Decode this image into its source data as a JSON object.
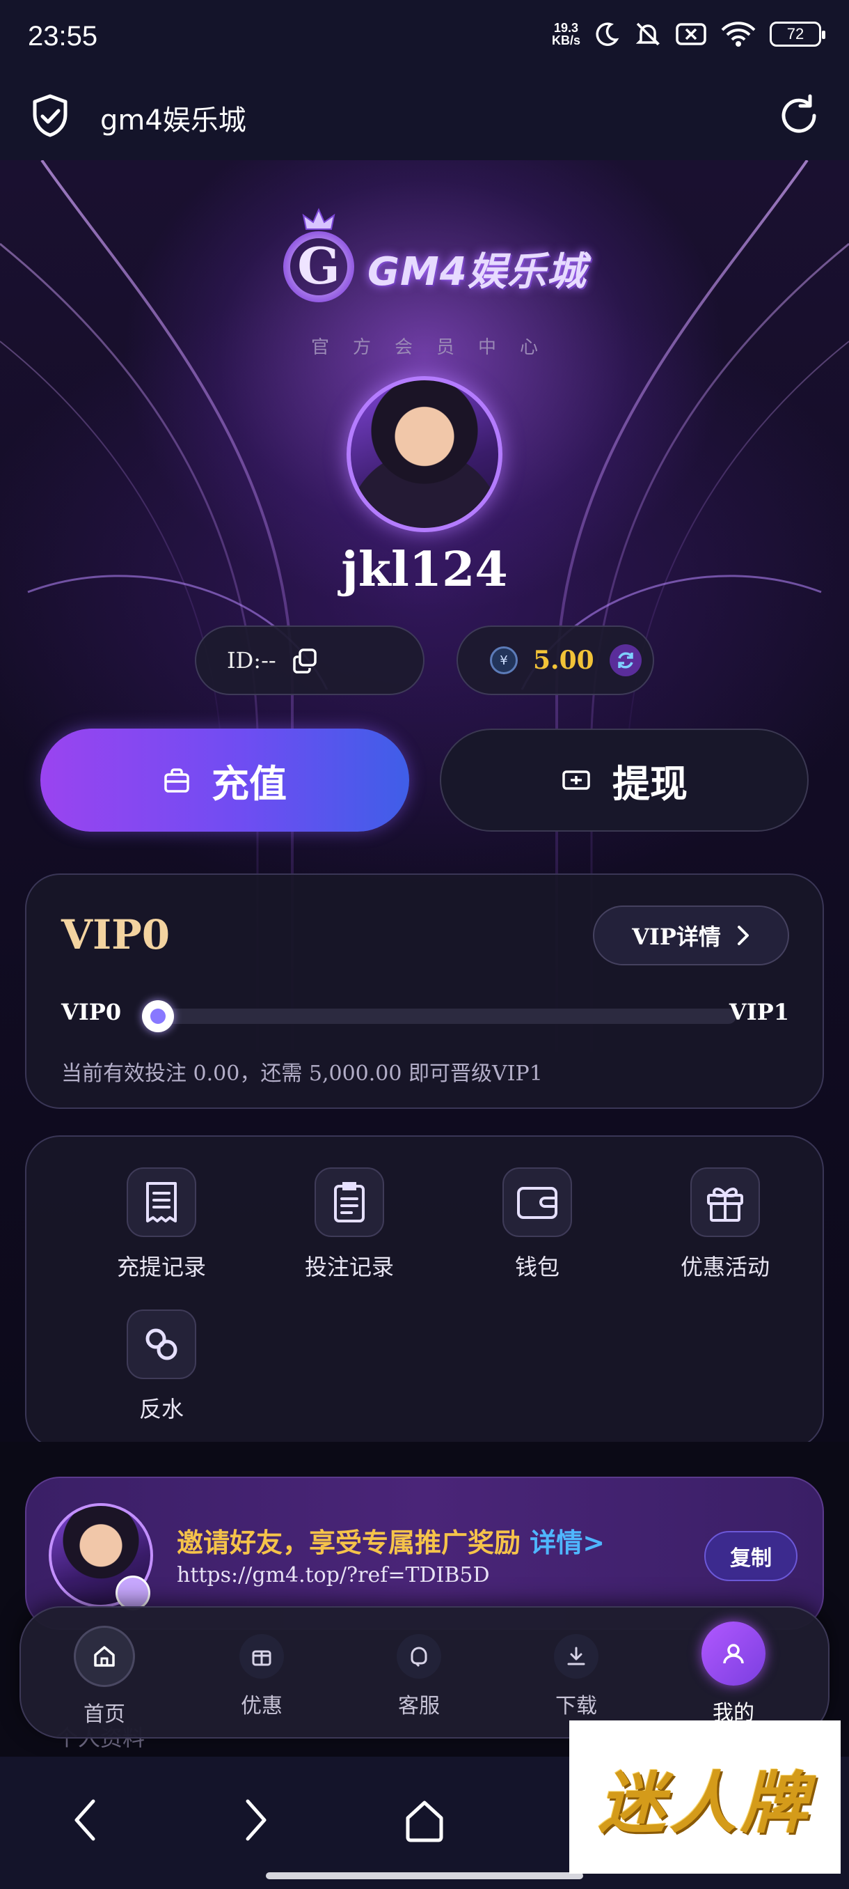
{
  "status_bar": {
    "time": "23:55",
    "speed_value": "19.3",
    "speed_unit": "KB/s",
    "battery": "72"
  },
  "header": {
    "title": "gm4娱乐城"
  },
  "hero": {
    "logo_text": "GM4娱乐城",
    "subtitle": "官方会员中心",
    "username": "jkl124"
  },
  "account": {
    "id_label": "ID:--",
    "currency_symbol": "¥",
    "balance": "5.00"
  },
  "actions": {
    "recharge_label": "充值",
    "withdraw_label": "提现"
  },
  "vip": {
    "current_level": "VIP0",
    "detail_label": "VIP详情",
    "start_label": "VIP0",
    "end_label": "VIP1",
    "progress": 0,
    "note": "当前有效投注 0.00，还需 5,000.00 即可晋级VIP1"
  },
  "menu": {
    "items": [
      {
        "label": "充提记录",
        "icon": "receipt-icon"
      },
      {
        "label": "投注记录",
        "icon": "clipboard-icon"
      },
      {
        "label": "钱包",
        "icon": "wallet-icon"
      },
      {
        "label": "优惠活动",
        "icon": "gift-icon"
      },
      {
        "label": "反水",
        "icon": "link-icon"
      }
    ]
  },
  "invite": {
    "title": "邀请好友，享受专属推广奖励",
    "detail_link": "详情>",
    "url": "https://gm4.top/?ref=TDIB5D",
    "copy_label": "复制"
  },
  "partial_row": {
    "label": "个人资料"
  },
  "tabbar": {
    "tabs": [
      {
        "label": "首页",
        "icon": "home-icon"
      },
      {
        "label": "优惠",
        "icon": "gift-box-icon"
      },
      {
        "label": "客服",
        "icon": "support-icon"
      },
      {
        "label": "下载",
        "icon": "download-icon"
      },
      {
        "label": "我的",
        "icon": "user-icon"
      }
    ],
    "active": "我的"
  },
  "watermark": {
    "text": "迷人牌"
  },
  "colors": {
    "accent_purple": "#9a44f0",
    "accent_blue": "#3f5ee8",
    "vip_gold": "#f3d3a0",
    "balance_gold": "#f2c338",
    "invite_blue": "#4fb6ff"
  }
}
